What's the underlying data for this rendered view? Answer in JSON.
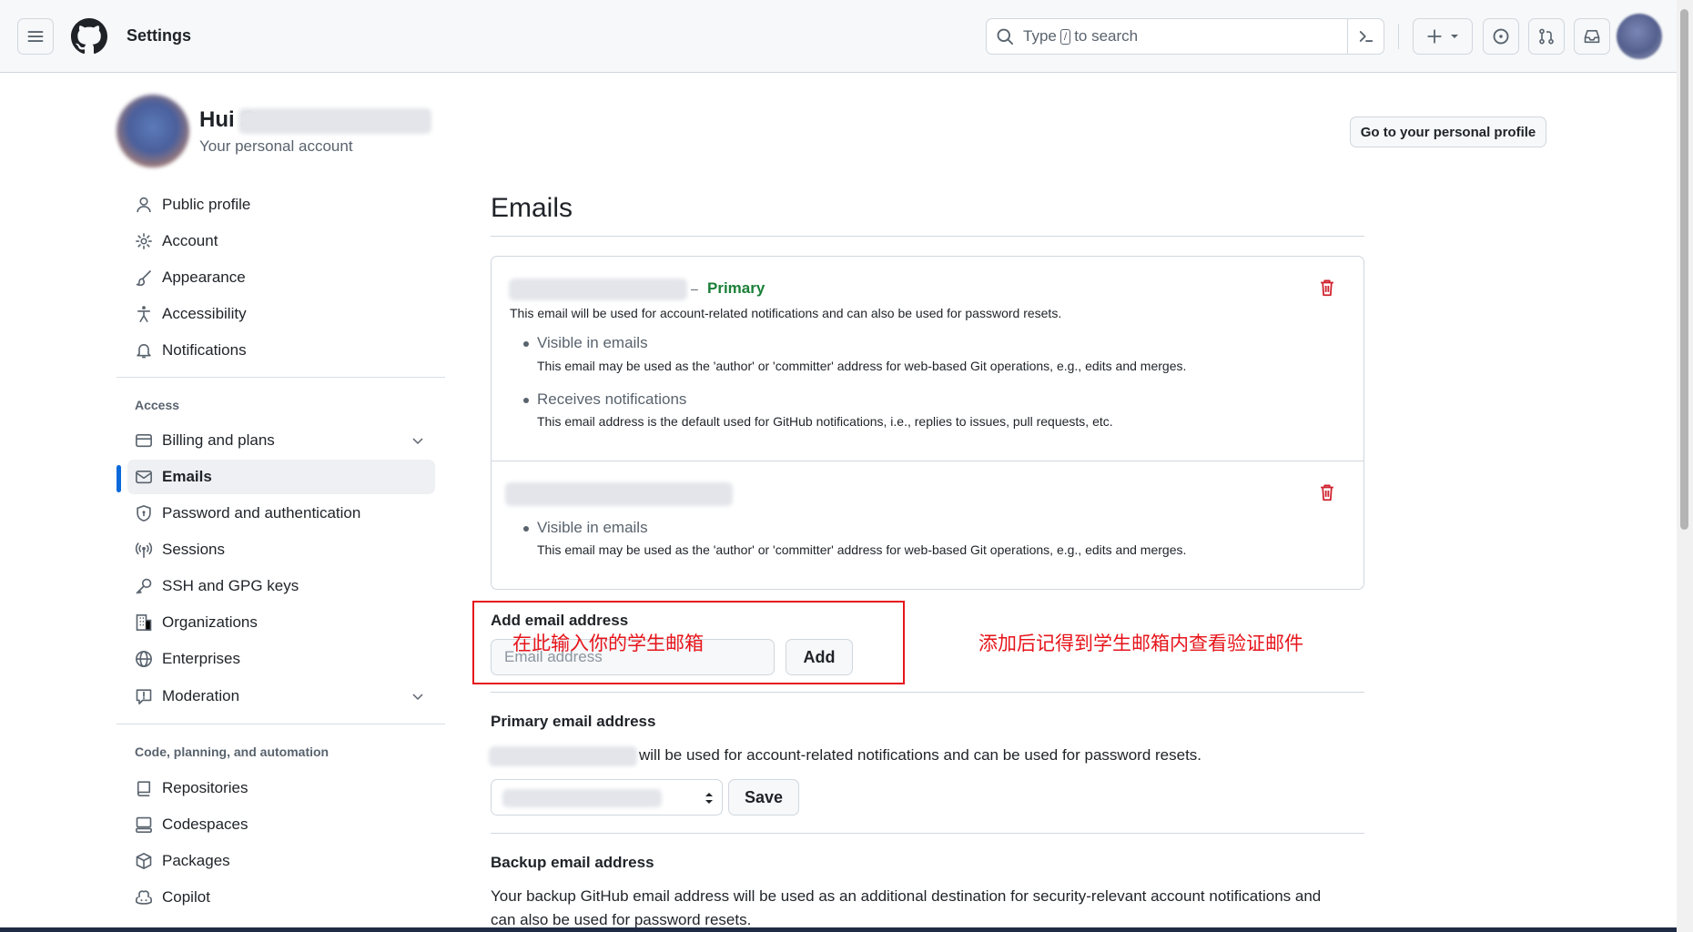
{
  "header": {
    "title": "Settings",
    "search_placeholder_pre": "Type",
    "search_key": "/",
    "search_placeholder_post": "to search"
  },
  "profile": {
    "name": "Hui S",
    "subtitle": "Your personal account",
    "profile_button": "Go to your personal profile"
  },
  "sidebar": {
    "items": [
      {
        "label": "Public profile",
        "icon": "person-icon"
      },
      {
        "label": "Account",
        "icon": "gear-icon"
      },
      {
        "label": "Appearance",
        "icon": "paintbrush-icon"
      },
      {
        "label": "Accessibility",
        "icon": "accessibility-icon"
      },
      {
        "label": "Notifications",
        "icon": "bell-icon"
      }
    ],
    "access_heading": "Access",
    "access_items": [
      {
        "label": "Billing and plans",
        "icon": "credit-card-icon"
      },
      {
        "label": "Emails",
        "icon": "mail-icon"
      },
      {
        "label": "Password and authentication",
        "icon": "shield-lock-icon"
      },
      {
        "label": "Sessions",
        "icon": "broadcast-icon"
      },
      {
        "label": "SSH and GPG keys",
        "icon": "key-icon"
      },
      {
        "label": "Organizations",
        "icon": "organization-icon"
      },
      {
        "label": "Enterprises",
        "icon": "globe-icon"
      },
      {
        "label": "Moderation",
        "icon": "report-icon"
      }
    ],
    "code_heading": "Code, planning, and automation",
    "code_items": [
      {
        "label": "Repositories",
        "icon": "repo-icon"
      },
      {
        "label": "Codespaces",
        "icon": "codespaces-icon"
      },
      {
        "label": "Packages",
        "icon": "package-icon"
      },
      {
        "label": "Copilot",
        "icon": "copilot-icon"
      }
    ]
  },
  "main": {
    "title": "Emails",
    "primary_label": "Primary",
    "primary_desc": "This email will be used for account-related notifications and can also be used for password resets.",
    "visible_title": "Visible in emails",
    "visible_desc": "This email may be used as the 'author' or 'committer' address for web-based Git operations, e.g., edits and merges.",
    "notif_title": "Receives notifications",
    "notif_desc": "This email address is the default used for GitHub notifications, i.e., replies to issues, pull requests, etc.",
    "add_label": "Add email address",
    "add_placeholder": "Email address",
    "add_button": "Add",
    "annotation_input": "在此输入你的学生邮箱",
    "annotation_right": "添加后记得到学生邮箱内查看验证邮件",
    "primary_section_title": "Primary email address",
    "primary_section_text": "will be used for account-related notifications and can be used for password resets.",
    "save_button": "Save",
    "backup_section_title": "Backup email address",
    "backup_section_text_1": "Your backup GitHub email address will be used as an additional destination for security-relevant account notifications and",
    "backup_section_text_2": "can also be used for password resets."
  },
  "colors": {
    "accent": "#0969da",
    "primary_green": "#1a7f37",
    "danger": "#cf222e",
    "annotation_red": "#e6141a"
  }
}
